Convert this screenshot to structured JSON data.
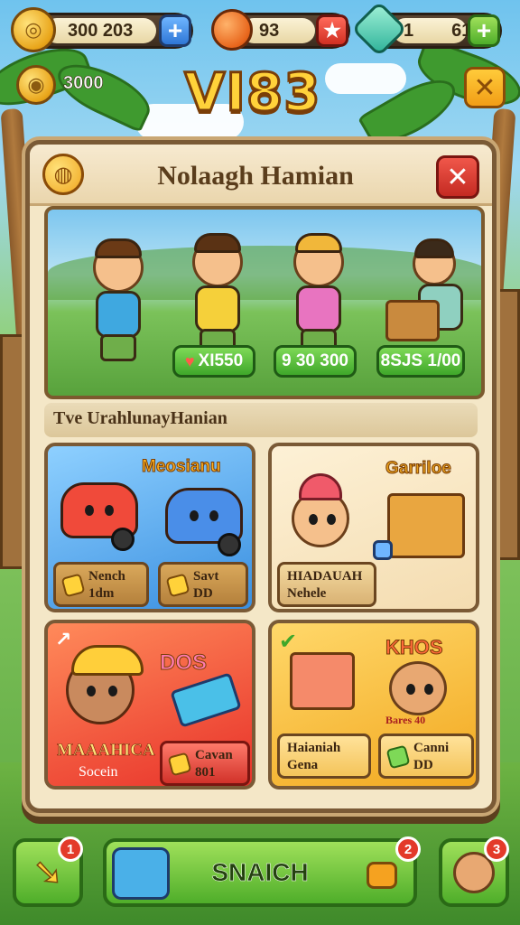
{
  "hud": {
    "currency1": "300  203",
    "currency2": "93",
    "currency3_left": "1",
    "currency3_right": "615",
    "coins": "3000",
    "plus": "+",
    "star": "★"
  },
  "game_title": "VI83",
  "panel": {
    "title": "Nolaagh Hamian",
    "close": "✕",
    "section_label": "Tve UrahlunayHanian"
  },
  "scene": {
    "prices": [
      {
        "label": "XI550"
      },
      {
        "label": "9 30 300"
      },
      {
        "label": "8SJS 1/00"
      }
    ]
  },
  "cards": {
    "vehicles": {
      "title": "Meosianu",
      "tag1": "Nench 1dm",
      "tag2": "Savt DD"
    },
    "gifts": {
      "title": "Garriloe",
      "line1": "HIADAUAH",
      "line2": "Nehele"
    },
    "hero": {
      "title": "DOS",
      "line1": "MAAAHICA",
      "line2": "Socein",
      "tag1": "Cavan 801"
    },
    "chest": {
      "title": "KHOS",
      "sub": "Bares 40",
      "line1": "Haianiah",
      "line2": "Gena",
      "tag1": "Canni DD"
    }
  },
  "bottom": {
    "back_badge": "1",
    "snatch_label": "SNAICH",
    "snatch_badge": "2",
    "right_badge": "3"
  },
  "colors": {
    "accent_gold": "#ffd23a",
    "panel_bg": "#f4e7c7",
    "button_green": "#4fae2a",
    "close_red": "#c42a22"
  }
}
